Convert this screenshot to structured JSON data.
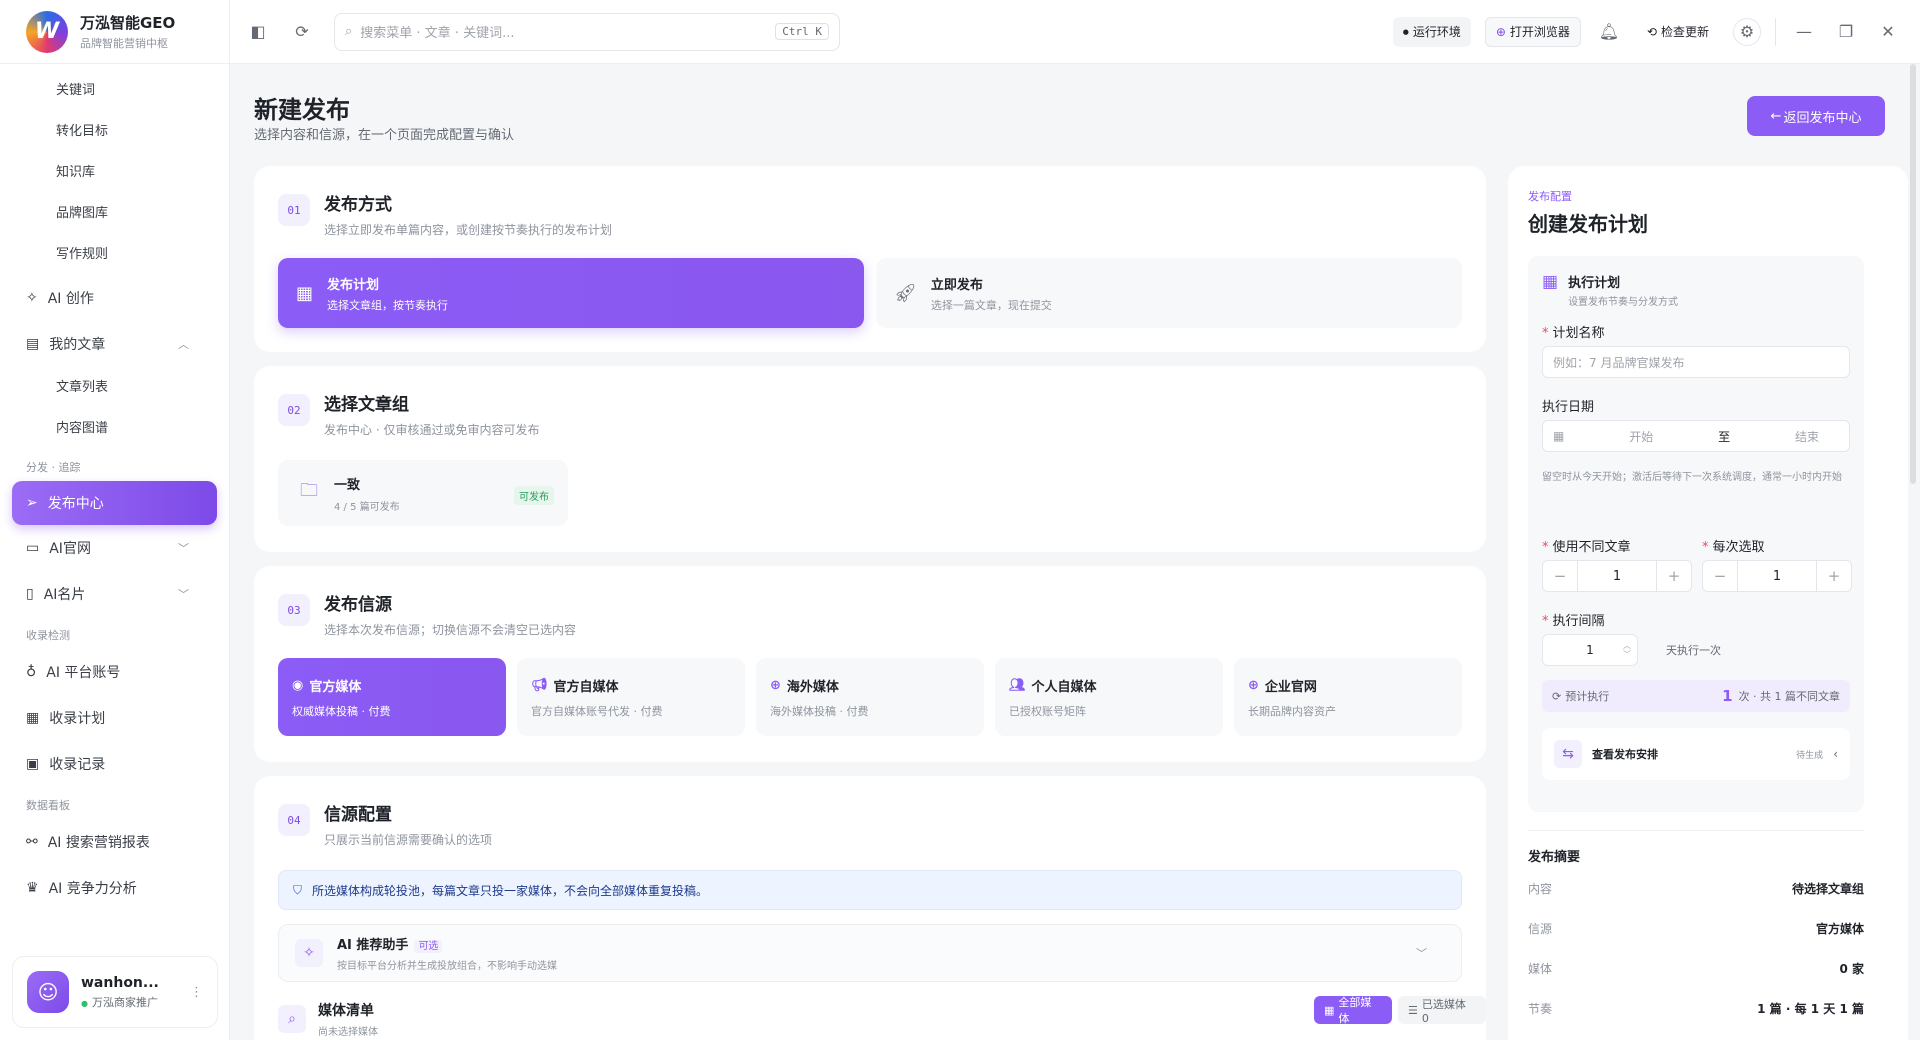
{
  "app": {
    "name": "万泓智能GEO",
    "subtitle": "品牌智能营销中枢",
    "logo_letter": "W"
  },
  "topbar": {
    "search_placeholder": "搜索菜单 · 文章 · 关键词...",
    "search_shortcut": "Ctrl K",
    "env_label": "运行环境",
    "browser_label": "打开浏览器",
    "update_label": "检查更新"
  },
  "sidebar": {
    "sub_items_top": [
      "关键词",
      "转化目标",
      "知识库",
      "品牌图库",
      "写作规则"
    ],
    "ai_create": "AI 创作",
    "my_articles": "我的文章",
    "article_subs": [
      "文章列表",
      "内容图谱"
    ],
    "group_distribute": "分发 · 追踪",
    "active_item": "发布中心",
    "ai_site": "AI官网",
    "ai_card": "AI名片",
    "group_monitor": "收录检测",
    "monitor_items": [
      "AI 平台账号",
      "收录计划",
      "收录记录"
    ],
    "group_data": "数据看板",
    "data_items": [
      "AI 搜索营销报表",
      "AI 竞争力分析"
    ],
    "user": {
      "name": "wanhon...",
      "role": "万泓商家推广"
    }
  },
  "page": {
    "title": "新建发布",
    "subtitle": "选择内容和信源，在一个页面完成配置与确认",
    "back_button": "返回发布中心"
  },
  "sections": {
    "s1": {
      "num": "01",
      "title": "发布方式",
      "desc": "选择立即发布单篇内容，或创建按节奏执行的发布计划",
      "options": [
        {
          "title": "发布计划",
          "desc": "选择文章组，按节奏执行"
        },
        {
          "title": "立即发布",
          "desc": "选择一篇文章，现在提交"
        }
      ]
    },
    "s2": {
      "num": "02",
      "title": "选择文章组",
      "desc": "发布中心 · 仅审核通过或免审内容可发布",
      "group": {
        "name": "一致",
        "count": "4 / 5 篇可发布",
        "badge": "可发布"
      }
    },
    "s3": {
      "num": "03",
      "title": "发布信源",
      "desc": "选择本次发布信源；切换信源不会清空已选内容",
      "sources": [
        {
          "title": "官方媒体",
          "desc": "权威媒体投稿 · 付费"
        },
        {
          "title": "官方自媒体",
          "desc": "官方自媒体账号代发 · 付费"
        },
        {
          "title": "海外媒体",
          "desc": "海外媒体投稿 · 付费"
        },
        {
          "title": "个人自媒体",
          "desc": "已授权账号矩阵"
        },
        {
          "title": "企业官网",
          "desc": "长期品牌内容资产"
        }
      ]
    },
    "s4": {
      "num": "04",
      "title": "信源配置",
      "desc": "只展示当前信源需要确认的选项",
      "notice": "所选媒体构成轮投池，每篇文章只投一家媒体，不会向全部媒体重复投稿。",
      "ai_title": "AI 推荐助手",
      "ai_tag": "可选",
      "ai_desc": "按目标平台分析并生成投放组合，不影响手动选媒",
      "media_title": "媒体清单",
      "media_desc": "尚未选择媒体",
      "all_media_btn": "全部媒体",
      "selected_media_btn": "已选媒体 0"
    }
  },
  "right_panel": {
    "label": "发布配置",
    "title": "创建发布计划",
    "plan": {
      "title": "执行计划",
      "desc": "设置发布节奏与分发方式",
      "name_label": "计划名称",
      "name_placeholder": "例如：7 月品牌官媒发布",
      "date_label": "执行日期",
      "date_start": "开始",
      "date_to": "至",
      "date_end": "结束",
      "date_hint": "留空时从今天开始；激活后等待下一次系统调度，通常一小时内开始",
      "diff_label": "使用不同文章",
      "diff_value": "1",
      "pick_label": "每次选取",
      "pick_value": "1",
      "interval_label": "执行间隔",
      "interval_value": "1",
      "interval_unit": "天执行一次",
      "estimate_label": "预计执行",
      "estimate_num": "1",
      "estimate_text": "次 · 共 1 篇不同文章",
      "view_label": "查看发布安排",
      "view_status": "待生成"
    },
    "summary": {
      "title": "发布摘要",
      "rows": [
        {
          "k": "内容",
          "v": "待选择文章组"
        },
        {
          "k": "信源",
          "v": "官方媒体"
        },
        {
          "k": "媒体",
          "v": "0 家"
        },
        {
          "k": "节奏",
          "v": "1 篇 · 每 1 天 1 篇"
        }
      ]
    }
  },
  "colors": {
    "accent": "#8b5cf6",
    "accent_dark": "#7d4ae8",
    "notice_bg": "#eef4ff",
    "success": "#2a9d5c"
  }
}
